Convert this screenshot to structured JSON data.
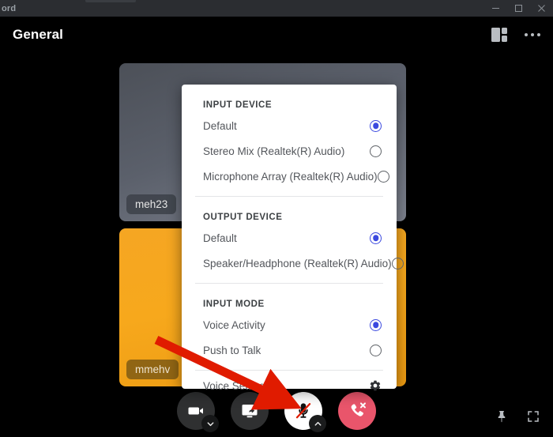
{
  "window": {
    "app_title": "ord",
    "controls": {
      "minimize": "minimize-button",
      "maximize": "maximize-button",
      "close": "close-button"
    }
  },
  "header": {
    "title": "General",
    "actions": [
      {
        "name": "layout-icon",
        "label": "Change layout"
      },
      {
        "name": "more-options-icon",
        "label": "More options"
      }
    ]
  },
  "stage": {
    "tiles": [
      {
        "name": "meh23",
        "accent": "#5b606b"
      },
      {
        "name": "mmehv",
        "accent": "#f5a623"
      }
    ]
  },
  "popup": {
    "sections": [
      {
        "title": "INPUT DEVICE",
        "options": [
          {
            "label": "Default",
            "selected": true
          },
          {
            "label": "Stereo Mix (Realtek(R) Audio)",
            "selected": false
          },
          {
            "label": "Microphone Array (Realtek(R) Audio)",
            "selected": false
          }
        ]
      },
      {
        "title": "OUTPUT DEVICE",
        "options": [
          {
            "label": "Default",
            "selected": true
          },
          {
            "label": "Speaker/Headphone (Realtek(R) Audio)",
            "selected": false
          }
        ]
      },
      {
        "title": "INPUT MODE",
        "options": [
          {
            "label": "Voice Activity",
            "selected": true
          },
          {
            "label": "Push to Talk",
            "selected": false
          }
        ]
      }
    ],
    "footer": {
      "label": "Voice Settings",
      "icon": "gear-icon"
    },
    "accent_color": "#3b49df"
  },
  "controls": {
    "camera": {
      "label": "Turn on camera",
      "state": "off",
      "has_menu": true
    },
    "screen_share": {
      "label": "Share your screen",
      "state": "off",
      "has_menu": false
    },
    "microphone": {
      "label": "Unmute",
      "state": "muted",
      "has_menu": true
    },
    "hangup": {
      "label": "Disconnect",
      "color": "#e9556b"
    },
    "pin": {
      "label": "Pin"
    },
    "fullscreen": {
      "label": "Full screen"
    }
  },
  "annotation": {
    "type": "arrow",
    "color": "#e01b00",
    "points_to": "microphone-button"
  }
}
